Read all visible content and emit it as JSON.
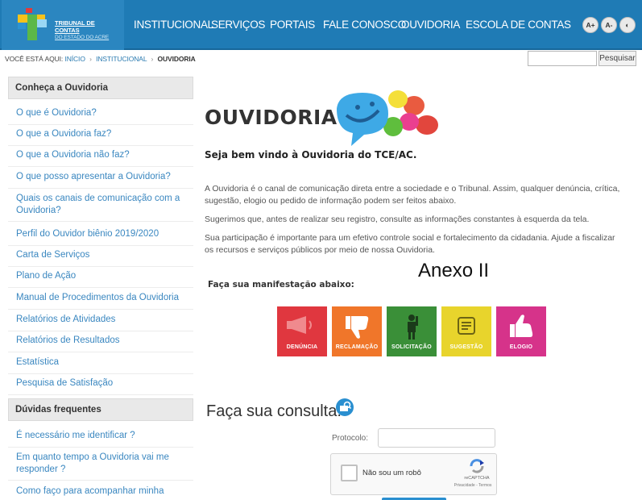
{
  "header": {
    "logo_line1": "TRIBUNAL DE CONTAS",
    "logo_line2": "DO ESTADO DO ACRE",
    "nav": [
      "INSTITUCIONAL",
      "SERVIÇOS",
      "PORTAIS",
      "FALE CONOSCO",
      "OUVIDORIA",
      "ESCOLA DE CONTAS"
    ],
    "accessibility": [
      "A+",
      "A-",
      "◐"
    ]
  },
  "breadcrumb": {
    "prefix": "VOCÊ ESTÁ AQUI:",
    "items": [
      "INÍCIO",
      "INSTITUCIONAL"
    ],
    "current": "OUVIDORIA",
    "separator": "›"
  },
  "search": {
    "placeholder": "",
    "button_label": "Pesquisar"
  },
  "sidebar": {
    "section1_title": "Conheça a Ouvidoria",
    "section1_items": [
      "O que é Ouvidoria?",
      "O que a Ouvidoria faz?",
      "O que a Ouvidoria não faz?",
      "O que posso apresentar a Ouvidoria?",
      "Quais os canais de comunicação com a Ouvidoria?",
      "Perfil do Ouvidor biênio 2019/2020",
      "Carta de Serviços",
      "Plano de Ação",
      "Manual de Procedimentos da Ouvidoria",
      "Relatórios de Atividades",
      "Relatórios de Resultados",
      "Estatística",
      "Pesquisa de Satisfação"
    ],
    "section2_title": "Dúvidas frequentes",
    "section2_items": [
      "É necessário me identificar ?",
      "Em quanto tempo a Ouvidoria vai me responder ?",
      "Como faço para acompanhar minha"
    ]
  },
  "main": {
    "title": "OUVIDORIA",
    "welcome": "Seja bem vindo à Ouvidoria do TCE/AC.",
    "paragraphs": [
      "A Ouvidoria é o canal de comunicação direta entre a sociedade e o Tribunal. Assim, qualquer denúncia, crítica, sugestão, elogio ou pedido de informação podem ser feitos abaixo.",
      "Sugerimos que, antes de realizar seu registro, consulte as informações constantes à esquerda da tela.",
      "Sua participação é importante para um efetivo controle social e fortalecimento da cidadania. Ajude a fiscalizar os recursos e serviços públicos por meio de nossa Ouvidoria."
    ],
    "annex_label": "Anexo II",
    "manifest_title": "Faça sua manifestação abaixo:",
    "tiles": [
      {
        "label": "DENÚNCIA",
        "color": "#e0373f",
        "icon": "megaphone-icon"
      },
      {
        "label": "RECLAMAÇÃO",
        "color": "#f0762a",
        "icon": "thumbs-down-icon"
      },
      {
        "label": "SOLICITAÇÃO",
        "color": "#3a8f38",
        "icon": "person-icon"
      },
      {
        "label": "SUGESTÃO",
        "color": "#e8d42c",
        "icon": "note-icon"
      },
      {
        "label": "ELOGIO",
        "color": "#d6338a",
        "icon": "thumbs-up-icon"
      }
    ],
    "consulta_title": "Faça sua consulta:",
    "protocolo_label": "Protocolo:",
    "protocolo_value": "",
    "captcha_label": "Não sou um robô",
    "captcha_brand": "reCAPTCHA",
    "captcha_links": "Privacidade - Termos"
  },
  "colors": {
    "header_bg": "#1f7bb5",
    "link": "#3a87c0",
    "sidebar_header_bg": "#e9e9e9"
  }
}
